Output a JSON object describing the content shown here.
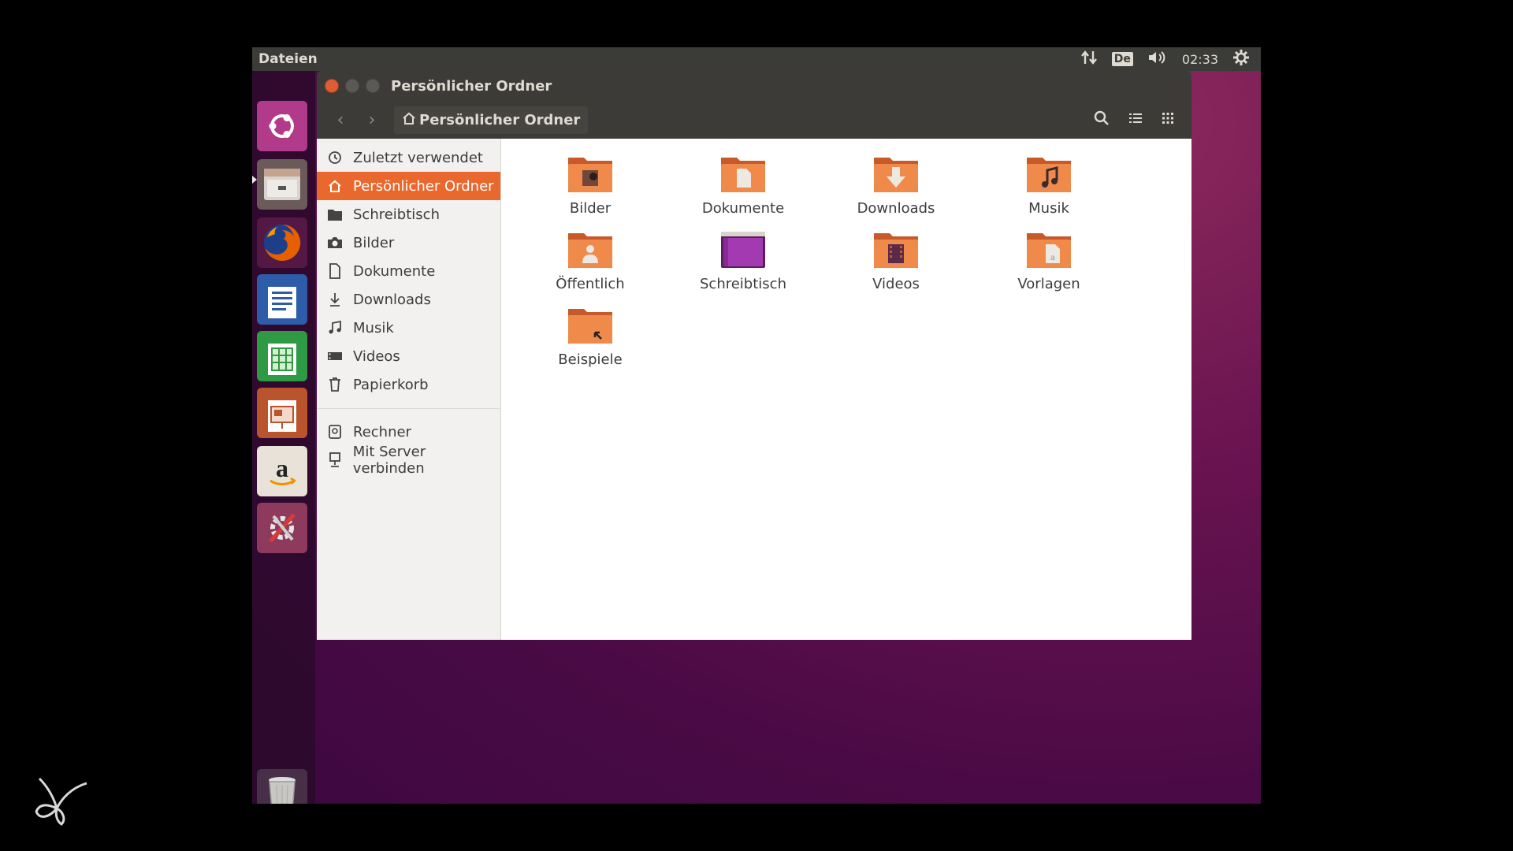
{
  "topbar": {
    "app_name": "Dateien",
    "keyboard_layout": "De",
    "clock": "02:33"
  },
  "window": {
    "title": "Persönlicher Ordner"
  },
  "toolbar": {
    "breadcrumb": "Persönlicher Ordner"
  },
  "sidebar": {
    "items": [
      {
        "label": "Zuletzt verwendet",
        "icon": "clock-icon"
      },
      {
        "label": "Persönlicher Ordner",
        "icon": "home-icon"
      },
      {
        "label": "Schreibtisch",
        "icon": "folder-icon"
      },
      {
        "label": "Bilder",
        "icon": "camera-icon"
      },
      {
        "label": "Dokumente",
        "icon": "document-icon"
      },
      {
        "label": "Downloads",
        "icon": "download-icon"
      },
      {
        "label": "Musik",
        "icon": "music-icon"
      },
      {
        "label": "Videos",
        "icon": "video-icon"
      },
      {
        "label": "Papierkorb",
        "icon": "trash-icon"
      },
      {
        "label": "Rechner",
        "icon": "drive-icon"
      },
      {
        "label": "Mit Server verbinden",
        "icon": "network-icon"
      }
    ]
  },
  "files": [
    {
      "label": "Bilder",
      "icon": "pictures-folder-icon"
    },
    {
      "label": "Dokumente",
      "icon": "documents-folder-icon"
    },
    {
      "label": "Downloads",
      "icon": "downloads-folder-icon"
    },
    {
      "label": "Musik",
      "icon": "music-folder-icon"
    },
    {
      "label": "Öffentlich",
      "icon": "public-folder-icon"
    },
    {
      "label": "Schreibtisch",
      "icon": "desktop-folder-icon"
    },
    {
      "label": "Videos",
      "icon": "videos-folder-icon"
    },
    {
      "label": "Vorlagen",
      "icon": "templates-folder-icon"
    },
    {
      "label": "Beispiele",
      "icon": "examples-folder-icon"
    }
  ],
  "colors": {
    "accent": "#e9682d",
    "desktop": "#5e1050",
    "panel": "#3b3b37"
  }
}
